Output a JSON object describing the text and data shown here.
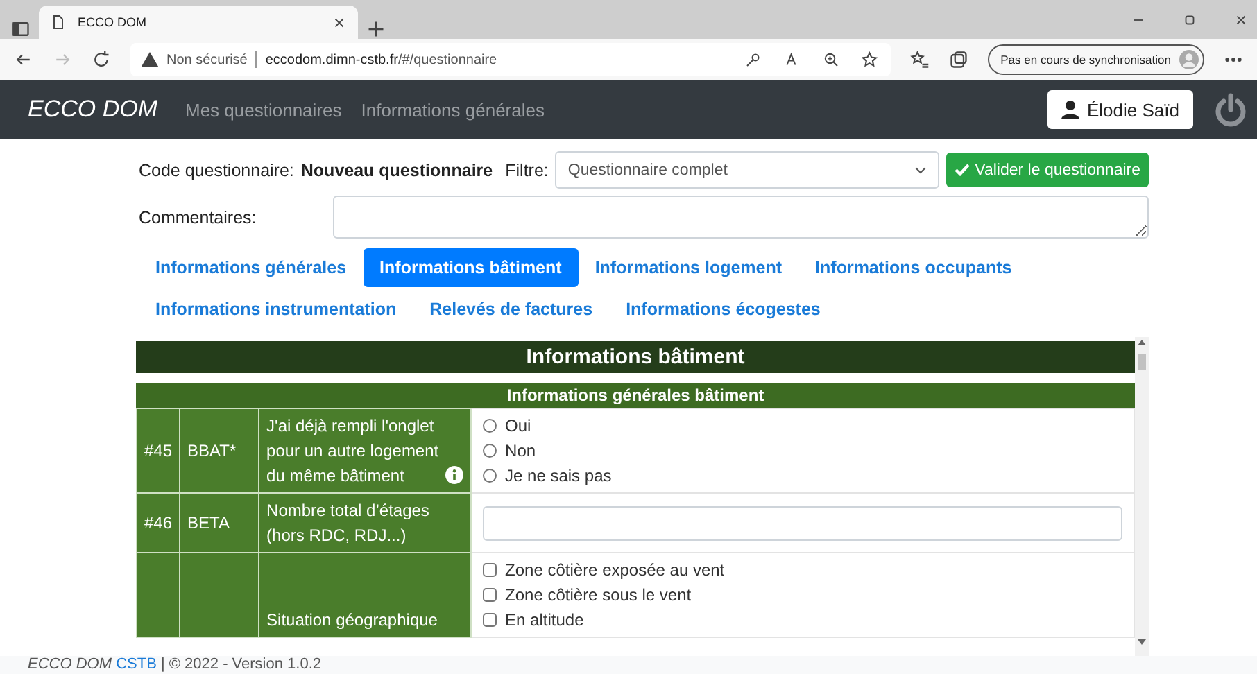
{
  "browser": {
    "tab_title": "ECCO DOM",
    "security": "Non sécurisé",
    "url_host": "eccodom.dimn-cstb.fr",
    "url_path": "/#/questionnaire",
    "sync": "Pas en cours de synchronisation"
  },
  "navbar": {
    "brand": "ECCO DOM",
    "links": [
      "Mes questionnaires",
      "Informations générales"
    ],
    "user": "Élodie Saïd"
  },
  "form": {
    "code_label": "Code questionnaire:",
    "code_value": "Nouveau questionnaire",
    "filter_label": "Filtre:",
    "filter_value": "Questionnaire complet",
    "validate_button": "Valider le questionnaire",
    "comments_label": "Commentaires:"
  },
  "tabs": [
    {
      "label": "Informations générales",
      "selected": false
    },
    {
      "label": "Informations bâtiment",
      "selected": true
    },
    {
      "label": "Informations logement",
      "selected": false
    },
    {
      "label": "Informations occupants",
      "selected": false
    },
    {
      "label": "Informations instrumentation",
      "selected": false
    },
    {
      "label": "Relevés de factures",
      "selected": false
    },
    {
      "label": "Informations écogestes",
      "selected": false
    }
  ],
  "table": {
    "title": "Informations bâtiment",
    "section": "Informations générales bâtiment",
    "rows": [
      {
        "number": "#45",
        "code": "BBAT*",
        "question": "J'ai déjà rempli l'onglet pour un autre logement du même bâtiment",
        "info": true,
        "kind": "radio",
        "options": [
          {
            "label": "Oui",
            "checked": false
          },
          {
            "label": "Non",
            "checked": false
          },
          {
            "label": "Je ne sais pas",
            "checked": false
          }
        ]
      },
      {
        "number": "#46",
        "code": "BETA",
        "question": "Nombre total d’étages (hors RDC, RDJ...)",
        "info": false,
        "kind": "text"
      },
      {
        "question": "Situation géographique",
        "info": false,
        "kind": "checkbox",
        "options": [
          {
            "label": "Zone côtière exposée au vent",
            "checked": false
          },
          {
            "label": "Zone côtière sous le vent",
            "checked": false
          },
          {
            "label": "En altitude",
            "checked": false
          }
        ]
      }
    ]
  },
  "footer": {
    "brand": "ECCO DOM",
    "link": "CSTB",
    "text": "| © 2022 - Version 1.0.2"
  }
}
